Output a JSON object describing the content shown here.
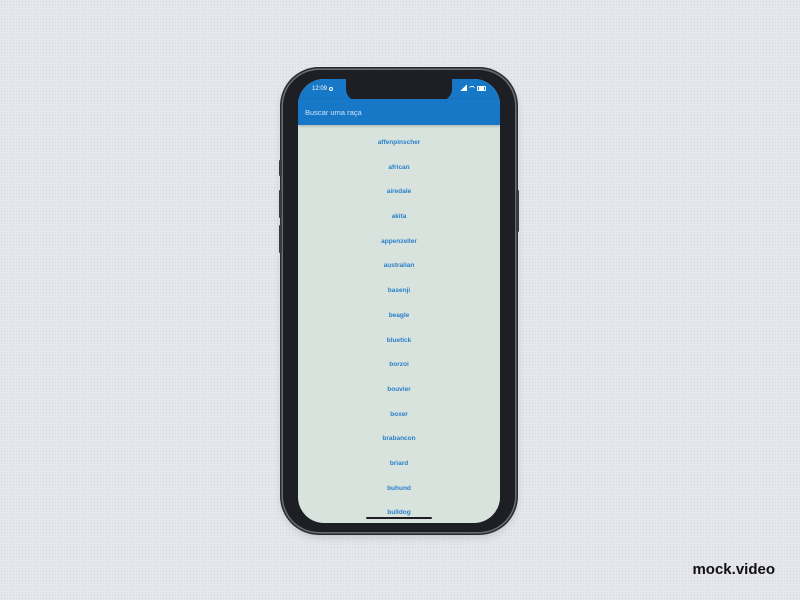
{
  "status_bar": {
    "time": "12:09",
    "icons": [
      "settings-dot-icon",
      "signal-icon",
      "wifi-icon",
      "battery-icon"
    ]
  },
  "app_bar": {
    "search_placeholder": "Buscar uma raça",
    "search_value": ""
  },
  "breeds": [
    "affenpinscher",
    "african",
    "airedale",
    "akita",
    "appenzeller",
    "australian",
    "basenji",
    "beagle",
    "bluetick",
    "borzoi",
    "bouvier",
    "boxer",
    "brabancon",
    "briard",
    "buhund",
    "bulldog"
  ],
  "colors": {
    "accent": "#1878c8",
    "list_text": "#2a7fc9",
    "screen_background": "#d9e3de"
  },
  "watermark": "mock.video"
}
